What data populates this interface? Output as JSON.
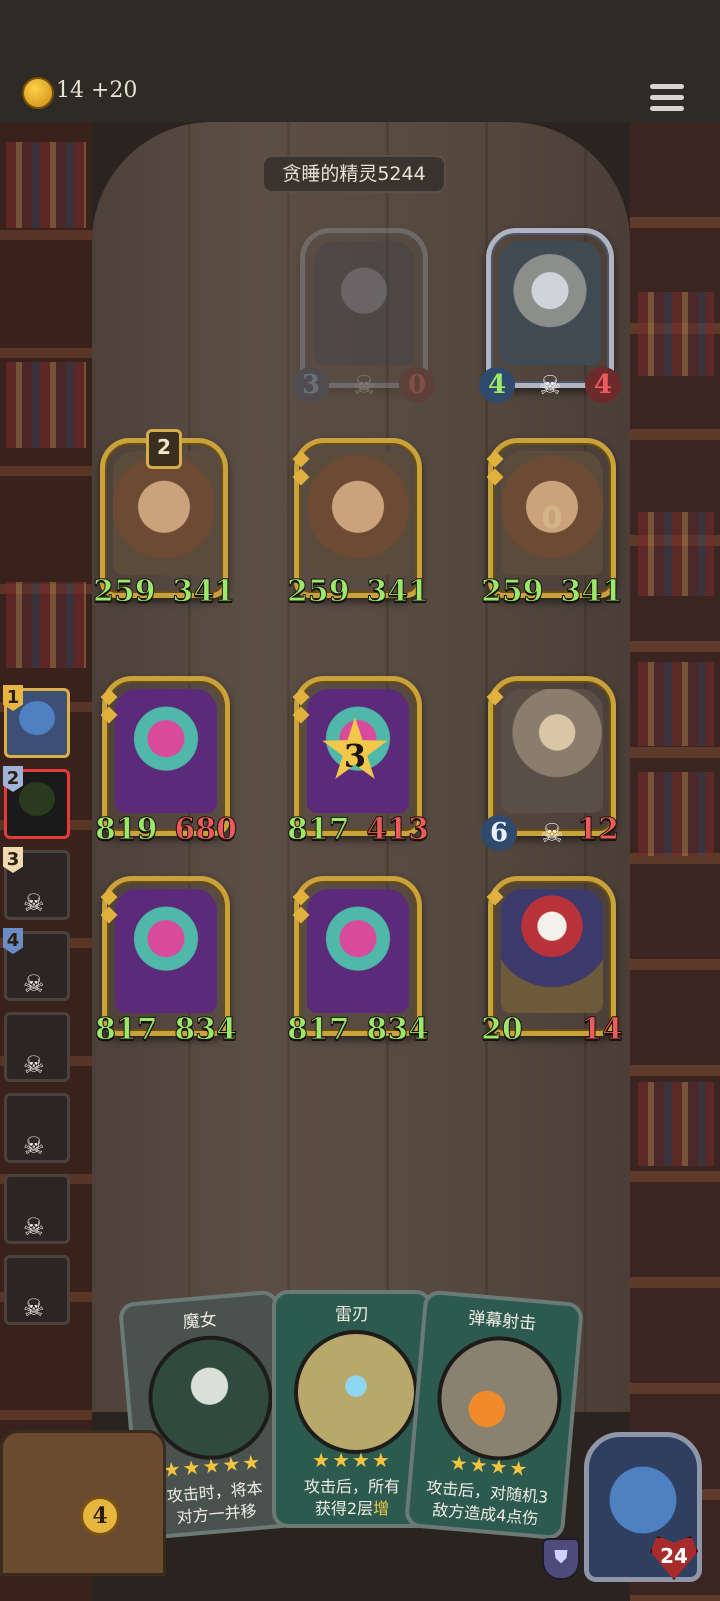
{
  "top": {
    "gold": "14",
    "gold_income": "+20",
    "coin_icon": "crown-coin-icon",
    "menu_icon": "menu-icon"
  },
  "opponent_label": "贪睡的精灵5244",
  "enemy_row": [
    {
      "name": "ghost-card",
      "atk": "3",
      "hp": "0",
      "faded": true
    },
    {
      "name": "robot-card",
      "atk": "4",
      "hp": "4"
    }
  ],
  "mid_row": [
    {
      "atk": "259",
      "hp": "341",
      "level": "2"
    },
    {
      "atk": "259",
      "hp": "341"
    },
    {
      "atk": "259",
      "hp": "341",
      "ghost_zero": "0"
    }
  ],
  "row3": [
    {
      "atk": "819",
      "hp": "680"
    },
    {
      "atk": "817",
      "hp": "413",
      "burst": "3"
    },
    {
      "atk": "6",
      "hp": "12"
    }
  ],
  "row4": [
    {
      "atk": "817",
      "hp": "834"
    },
    {
      "atk": "817",
      "hp": "834"
    },
    {
      "atk": "20",
      "hp": "14"
    }
  ],
  "queue": [
    {
      "num": "1",
      "state": "active"
    },
    {
      "num": "2",
      "state": "hot"
    },
    {
      "num": "3",
      "state": "dead"
    },
    {
      "num": "4",
      "state": "dead"
    },
    {
      "num": "",
      "state": "dead"
    },
    {
      "num": "",
      "state": "dead"
    },
    {
      "num": "",
      "state": "dead"
    },
    {
      "num": "",
      "state": "dead"
    }
  ],
  "hand": [
    {
      "title": "魔女",
      "desc1": "攻击时，将本",
      "desc2": "对方一并移",
      "rarity": 5
    },
    {
      "title": "雷刃",
      "desc1": "攻击后，所有",
      "desc2_pre": "获得2层",
      "desc2_hl": "增",
      "rarity": 4
    },
    {
      "title": "弹幕射击",
      "desc1": "攻击后，对随机3",
      "desc2": "敌方造成4点伤",
      "rarity": 4
    }
  ],
  "energy": "4",
  "hero_hp": "24",
  "colors": {
    "gold_frame": "#c9a23b",
    "atk_green": "#9be86a",
    "hp_red": "#ef5a5a",
    "stat_blue": "#8fd0ff"
  }
}
